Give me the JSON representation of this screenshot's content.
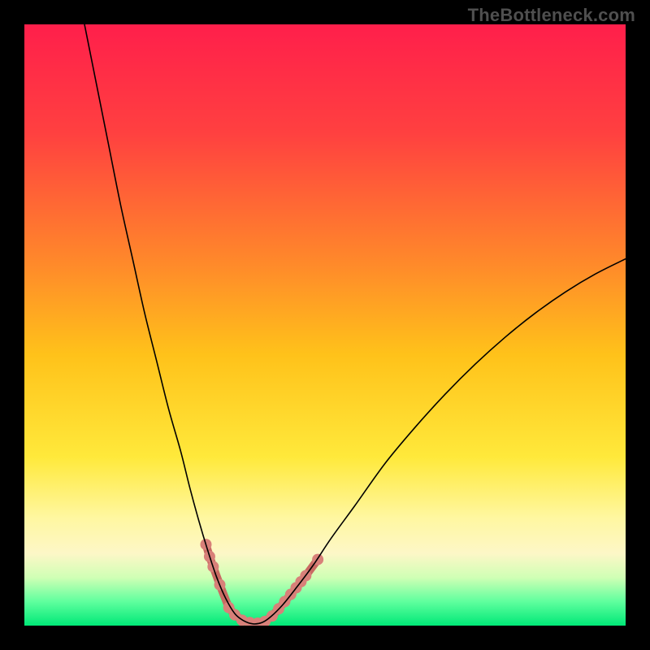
{
  "watermark": "TheBottleneck.com",
  "chart_data": {
    "type": "line",
    "title": "",
    "xlabel": "",
    "ylabel": "",
    "xlim": [
      0,
      100
    ],
    "ylim": [
      0,
      100
    ],
    "background_gradient": {
      "stops": [
        {
          "offset": 0.0,
          "color": "#ff1f4b"
        },
        {
          "offset": 0.18,
          "color": "#ff4040"
        },
        {
          "offset": 0.4,
          "color": "#ff8a2a"
        },
        {
          "offset": 0.55,
          "color": "#ffc21a"
        },
        {
          "offset": 0.72,
          "color": "#ffe93b"
        },
        {
          "offset": 0.82,
          "color": "#fff7a0"
        },
        {
          "offset": 0.88,
          "color": "#fdf7c7"
        },
        {
          "offset": 0.92,
          "color": "#d0ffb5"
        },
        {
          "offset": 0.96,
          "color": "#5fff9e"
        },
        {
          "offset": 1.0,
          "color": "#00e877"
        }
      ]
    },
    "series": [
      {
        "name": "curve",
        "color": "#000000",
        "width": 1.6,
        "points": [
          {
            "x": 10.0,
            "y": 100.0
          },
          {
            "x": 12.0,
            "y": 90.0
          },
          {
            "x": 14.0,
            "y": 80.0
          },
          {
            "x": 16.0,
            "y": 70.0
          },
          {
            "x": 18.0,
            "y": 61.0
          },
          {
            "x": 20.0,
            "y": 52.0
          },
          {
            "x": 22.0,
            "y": 44.0
          },
          {
            "x": 24.0,
            "y": 36.0
          },
          {
            "x": 26.0,
            "y": 29.0
          },
          {
            "x": 27.5,
            "y": 23.0
          },
          {
            "x": 29.0,
            "y": 17.5
          },
          {
            "x": 30.5,
            "y": 12.5
          },
          {
            "x": 32.0,
            "y": 8.0
          },
          {
            "x": 33.5,
            "y": 4.5
          },
          {
            "x": 35.0,
            "y": 2.0
          },
          {
            "x": 36.5,
            "y": 0.8
          },
          {
            "x": 38.0,
            "y": 0.3
          },
          {
            "x": 39.5,
            "y": 0.5
          },
          {
            "x": 41.0,
            "y": 1.5
          },
          {
            "x": 43.0,
            "y": 3.5
          },
          {
            "x": 45.0,
            "y": 6.0
          },
          {
            "x": 48.0,
            "y": 10.0
          },
          {
            "x": 51.0,
            "y": 14.5
          },
          {
            "x": 55.0,
            "y": 20.0
          },
          {
            "x": 60.0,
            "y": 27.0
          },
          {
            "x": 65.0,
            "y": 33.0
          },
          {
            "x": 70.0,
            "y": 38.5
          },
          {
            "x": 75.0,
            "y": 43.5
          },
          {
            "x": 80.0,
            "y": 48.0
          },
          {
            "x": 85.0,
            "y": 52.0
          },
          {
            "x": 90.0,
            "y": 55.5
          },
          {
            "x": 95.0,
            "y": 58.5
          },
          {
            "x": 100.0,
            "y": 61.0
          }
        ]
      },
      {
        "name": "markers",
        "color": "#d88079",
        "marker_radius": 7,
        "stroke_color": "#c96a63",
        "stroke_width": 10,
        "points": [
          {
            "x": 30.2,
            "y": 13.5
          },
          {
            "x": 30.8,
            "y": 11.5
          },
          {
            "x": 31.4,
            "y": 9.8
          },
          {
            "x": 32.5,
            "y": 6.8
          },
          {
            "x": 34.0,
            "y": 3.0
          },
          {
            "x": 35.0,
            "y": 1.8
          },
          {
            "x": 36.2,
            "y": 0.9
          },
          {
            "x": 37.5,
            "y": 0.5
          },
          {
            "x": 38.8,
            "y": 0.4
          },
          {
            "x": 40.0,
            "y": 0.7
          },
          {
            "x": 41.2,
            "y": 1.6
          },
          {
            "x": 42.3,
            "y": 2.8
          },
          {
            "x": 43.3,
            "y": 4.0
          },
          {
            "x": 44.3,
            "y": 5.2
          },
          {
            "x": 45.2,
            "y": 6.3
          },
          {
            "x": 46.0,
            "y": 7.3
          },
          {
            "x": 46.8,
            "y": 8.3
          },
          {
            "x": 48.8,
            "y": 11.0
          }
        ]
      }
    ]
  }
}
